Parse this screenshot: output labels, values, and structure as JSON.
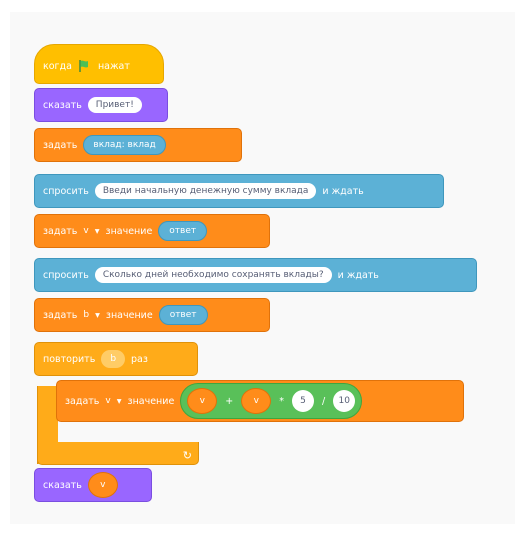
{
  "blocks": {
    "hat": {
      "label_left": "когда",
      "label_right": "нажат"
    },
    "say1": {
      "label": "сказать",
      "text": "Привет!"
    },
    "set_var": {
      "label": "задать",
      "var_text": "вклад: вклад"
    },
    "ask1": {
      "label": "спросить",
      "text": "Введи начальную денежную сумму вклада",
      "tail": "и ждать"
    },
    "set_answer1": {
      "label": "задать",
      "var": "v",
      "op": "значение",
      "value": "ответ"
    },
    "ask2": {
      "label": "спросить",
      "text": "Сколько дней необходимо сохранять вклады?",
      "tail": "и ждать"
    },
    "set_answer2": {
      "label": "задать",
      "var": "b",
      "op": "значение",
      "value": "ответ"
    },
    "repeat": {
      "label": "повторить",
      "count": "b",
      "unit": "раз"
    },
    "set_calc": {
      "label": "задать",
      "var": "v",
      "op": "значение",
      "a": "v",
      "plus": "+",
      "b": "v",
      "times": "*",
      "c": "5",
      "div": "/",
      "d": "10"
    },
    "say_end": {
      "label": "сказать",
      "value": "v"
    }
  },
  "colors": {
    "events": "#ffbf00",
    "looks": "#9966ff",
    "variables": "#ff8c1a",
    "sensing": "#5cb1d6",
    "control": "#ffab19",
    "operators": "#59c059"
  },
  "icons": [
    "green-flag-icon",
    "dropdown-arrow-icon",
    "loop-arrow-icon"
  ]
}
